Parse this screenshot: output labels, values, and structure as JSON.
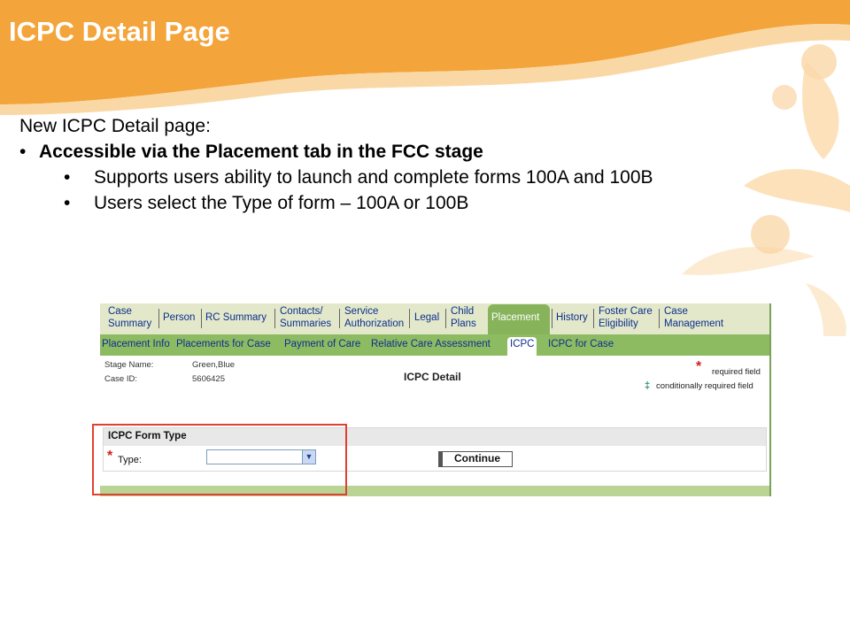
{
  "slide": {
    "title": "ICPC Detail Page",
    "intro": "New ICPC Detail page:",
    "bullet_main": "Accessible via the Placement tab in the FCC stage",
    "sub_bullets": [
      "Supports users ability to launch and complete forms 100A and 100B",
      "Users select the Type of form – 100A or 100B"
    ]
  },
  "app": {
    "tabs": [
      {
        "line1": "Case",
        "line2": "Summary"
      },
      {
        "line1": "Person",
        "line2": ""
      },
      {
        "line1": "RC Summary",
        "line2": ""
      },
      {
        "line1": "Contacts/",
        "line2": "Summaries"
      },
      {
        "line1": "Service",
        "line2": "Authorization"
      },
      {
        "line1": "Legal",
        "line2": ""
      },
      {
        "line1": "Child",
        "line2": "Plans"
      },
      {
        "line1": "Placement",
        "line2": ""
      },
      {
        "line1": "History",
        "line2": ""
      },
      {
        "line1": "Foster Care",
        "line2": "Eligibility"
      },
      {
        "line1": "Case",
        "line2": "Management"
      }
    ],
    "active_tab": "Placement",
    "subtabs": [
      "Placement Info",
      "Placements for Case",
      "Payment of Care",
      "Relative Care Assessment",
      "ICPC",
      "ICPC for Case"
    ],
    "active_subtab": "ICPC",
    "stage_name_label": "Stage Name:",
    "stage_name_value": "Green,Blue",
    "case_id_label": "Case ID:",
    "case_id_value": "5606425",
    "page_title": "ICPC Detail",
    "required_mark": "*",
    "required_text": "required field",
    "conditional_mark": "‡",
    "conditional_text": "conditionally required field",
    "section_title": "ICPC Form Type",
    "type_label": "Type:",
    "type_value": "",
    "continue_label": "Continue"
  },
  "colors": {
    "banner": "#f3a43a",
    "tab_bar": "#e2e8c9",
    "active_tab": "#87b45b",
    "subtab_bar": "#8dbb62",
    "link": "#0d2f8e",
    "highlight": "#e0412f"
  }
}
